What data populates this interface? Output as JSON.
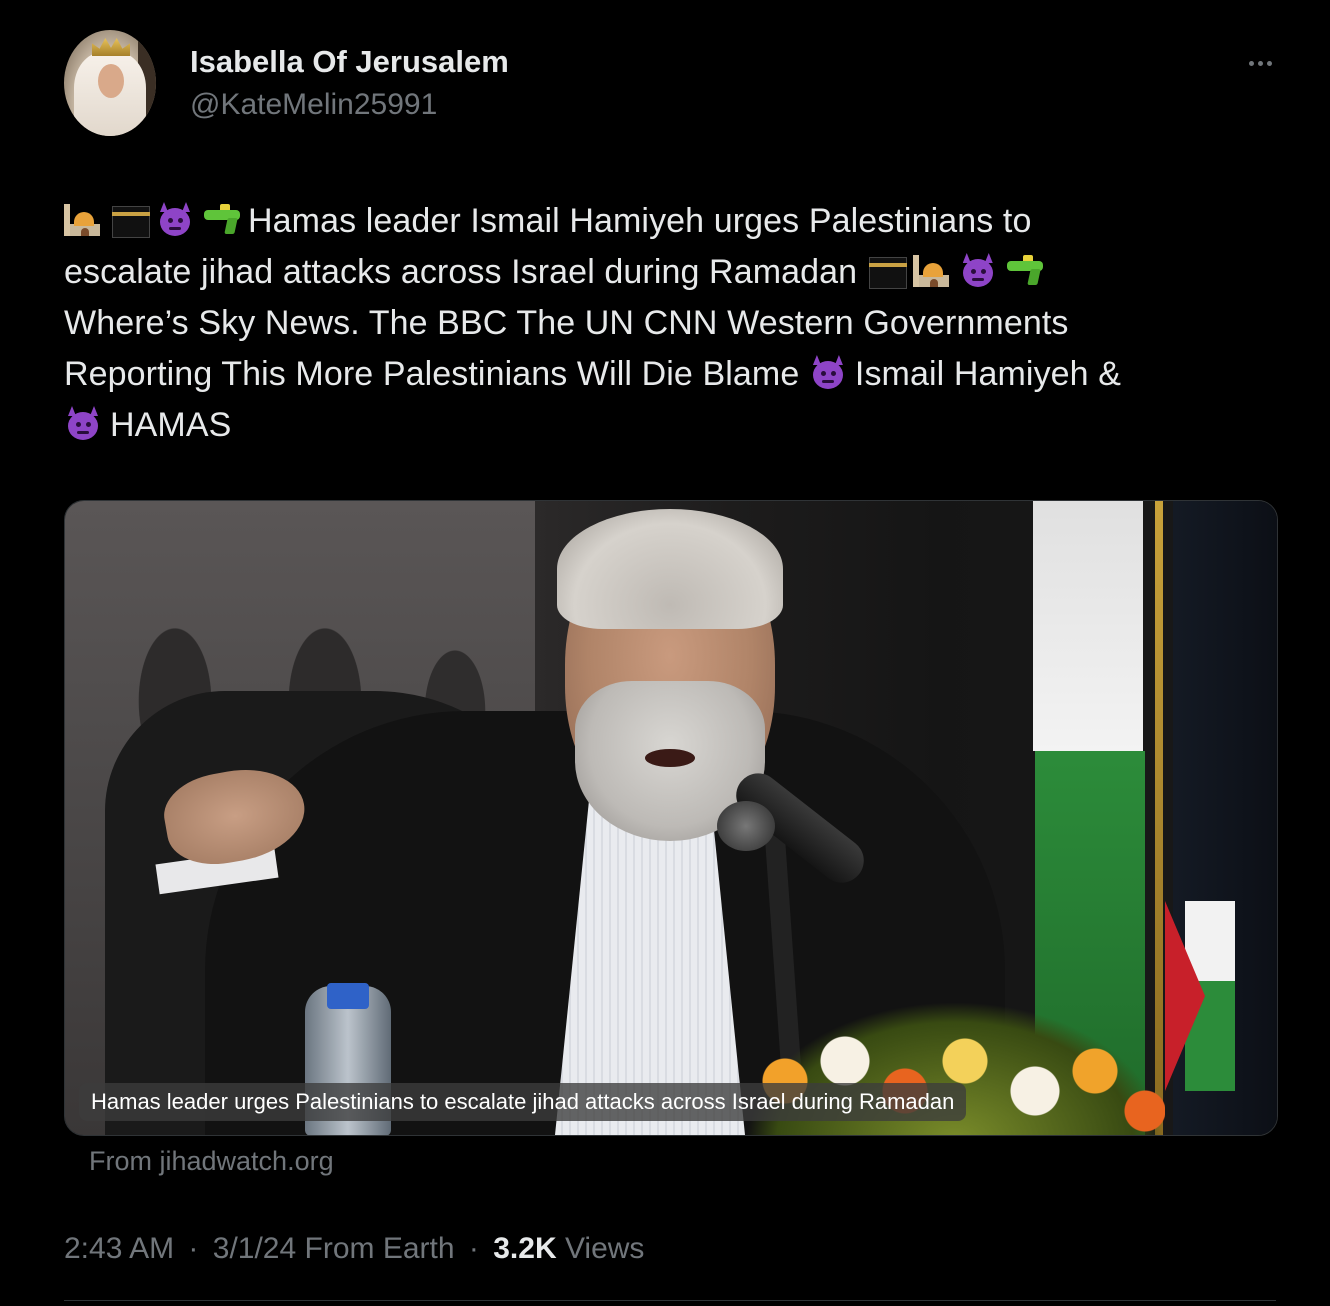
{
  "author": {
    "display_name": "Isabella Of Jerusalem",
    "handle": "@KateMelin25991"
  },
  "icons": {
    "more": "more-horizontal-icon",
    "mosque": "mosque-emoji",
    "kaaba": "kaaba-emoji",
    "imp": "imp-emoji",
    "water_pistol": "water-pistol-emoji"
  },
  "tweet": {
    "line1": "Hamas leader Ismail Hamiyeh  urges Palestinians to",
    "line2": "escalate jihad attacks across Israel during Ramadan",
    "line3": "Where’s Sky News. The BBC The UN CNN Western Governments",
    "line4a": "Reporting This   More Palestinians Will Die  Blame ",
    "line4b": "Ismail Hamiyeh &",
    "line5": "HAMAS"
  },
  "media": {
    "caption": "Hamas leader urges Palestinians to escalate jihad attacks across Israel during Ramadan",
    "source": "From jihadwatch.org"
  },
  "meta": {
    "time": "2:43 AM",
    "separator": "·",
    "date_location": "3/1/24 From Earth",
    "views_count": "3.2K",
    "views_label": "Views"
  },
  "colors": {
    "background": "#000000",
    "text_primary": "#e7e9ea",
    "text_secondary": "#71767b",
    "border": "#2f3336"
  }
}
